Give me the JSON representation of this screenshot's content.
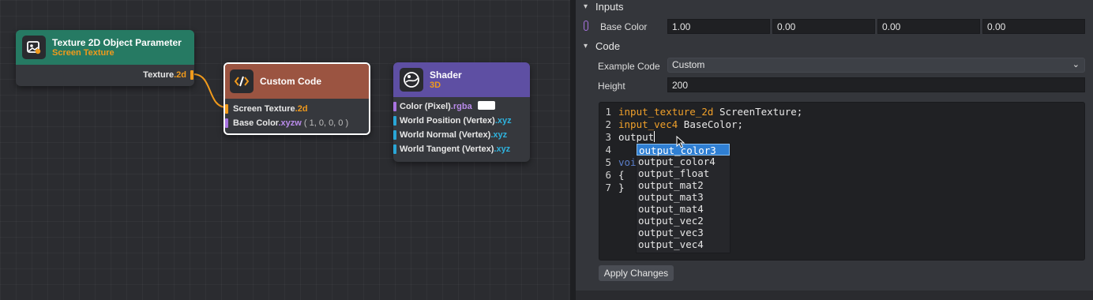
{
  "nodes": {
    "texture_param": {
      "title": "Texture 2D Object Parameter",
      "subtitle": "Screen Texture",
      "header_color": "#267a63",
      "icon": "image-settings-icon",
      "output_label": "Texture",
      "output_suffix": ".2d"
    },
    "custom_code": {
      "title": "Custom Code",
      "header_color": "#9b5441",
      "icon": "code-brackets-icon",
      "inputs": [
        {
          "label": "Screen Texture",
          "suffix": ".2d",
          "default": ""
        },
        {
          "label": "Base Color",
          "suffix": ".xyzw",
          "default": " ( 1, 0, 0, 0 )"
        }
      ]
    },
    "shader": {
      "title": "Shader",
      "subtitle": "3D",
      "header_color": "#5e4fa3",
      "icon": "sphere-icon",
      "inputs": [
        {
          "label": "Color (Pixel)",
          "suffix": ".rgba"
        },
        {
          "label": "World Position (Vertex)",
          "suffix": ".xyz"
        },
        {
          "label": "World Normal (Vertex)",
          "suffix": ".xyz"
        },
        {
          "label": "World Tangent (Vertex)",
          "suffix": ".xyz"
        }
      ]
    }
  },
  "panel": {
    "inputs_section": "Inputs",
    "base_color_label": "Base Color",
    "base_color_values": [
      "1.00",
      "0.00",
      "0.00",
      "0.00"
    ],
    "code_section": "Code",
    "example_code_label": "Example Code",
    "example_code_value": "Custom",
    "height_label": "Height",
    "height_value": "200",
    "code_lines": [
      {
        "kw": "input_texture_2d",
        "rest": " ScreenTexture;"
      },
      {
        "kw": "input_vec4",
        "rest": " BaseColor;"
      },
      {
        "kw": "",
        "rest": "output"
      },
      {
        "kw": "",
        "rest": ""
      },
      {
        "kw": "",
        "rest": "voi"
      },
      {
        "kw": "",
        "rest": "{"
      },
      {
        "kw": "",
        "rest": "}"
      }
    ],
    "line_numbers": [
      "1",
      "2",
      "3",
      "4",
      "5",
      "6",
      "7"
    ],
    "autocomplete": [
      "output_color3",
      "output_color4",
      "output_float",
      "output_mat2",
      "output_mat3",
      "output_mat4",
      "output_vec2",
      "output_vec3",
      "output_vec4"
    ],
    "autocomplete_selected": "output_color3",
    "apply_button": "Apply Changes"
  },
  "colors": {
    "accent_orange": "#f09a1c",
    "pin_purple": "#a873e0",
    "pin_cyan": "#2aa6d6",
    "selection_blue": "#2f7fd3"
  }
}
